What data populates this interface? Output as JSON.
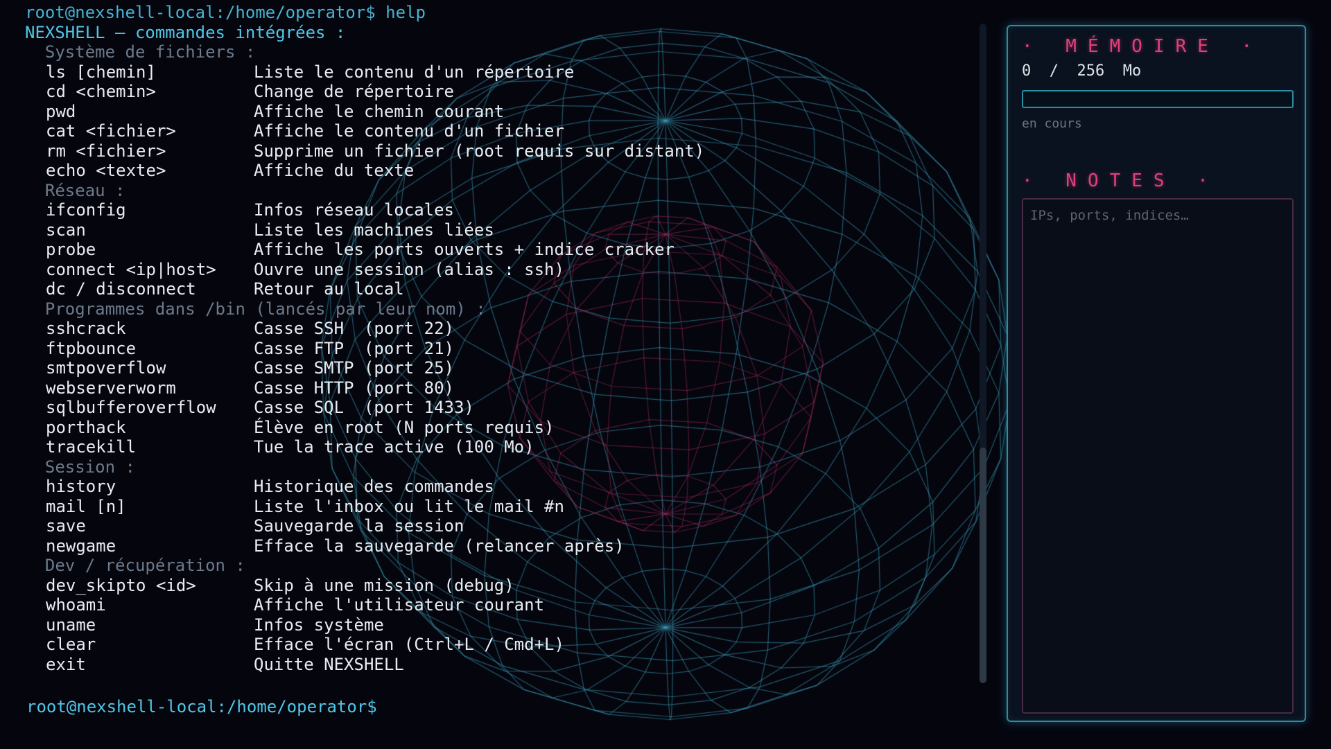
{
  "terminal": {
    "prev_prompt": "root@nexshell-local:/home/operator$ help",
    "title": "NEXSHELL — commandes intégrées :",
    "sections": [
      {
        "heading": "Système de fichiers :",
        "commands": [
          {
            "name": "ls [chemin]",
            "desc": "Liste le contenu d'un répertoire"
          },
          {
            "name": "cd <chemin>",
            "desc": "Change de répertoire"
          },
          {
            "name": "pwd",
            "desc": "Affiche le chemin courant"
          },
          {
            "name": "cat <fichier>",
            "desc": "Affiche le contenu d'un fichier"
          },
          {
            "name": "rm <fichier>",
            "desc": "Supprime un fichier (root requis sur distant)"
          },
          {
            "name": "echo <texte>",
            "desc": "Affiche du texte"
          }
        ]
      },
      {
        "heading": "Réseau :",
        "commands": [
          {
            "name": "ifconfig",
            "desc": "Infos réseau locales"
          },
          {
            "name": "scan",
            "desc": "Liste les machines liées"
          },
          {
            "name": "probe",
            "desc": "Affiche les ports ouverts + indice cracker"
          },
          {
            "name": "connect <ip|host>",
            "desc": "Ouvre une session (alias : ssh)"
          },
          {
            "name": "dc / disconnect",
            "desc": "Retour au local"
          }
        ]
      },
      {
        "heading": "Programmes dans /bin (lancés par leur nom) :",
        "commands": [
          {
            "name": "sshcrack",
            "desc": "Casse SSH  (port 22)"
          },
          {
            "name": "ftpbounce",
            "desc": "Casse FTP  (port 21)"
          },
          {
            "name": "smtpoverflow",
            "desc": "Casse SMTP (port 25)"
          },
          {
            "name": "webserverworm",
            "desc": "Casse HTTP (port 80)"
          },
          {
            "name": "sqlbufferoverflow",
            "desc": "Casse SQL  (port 1433)"
          },
          {
            "name": "porthack",
            "desc": "Élève en root (N ports requis)"
          },
          {
            "name": "tracekill",
            "desc": "Tue la trace active (100 Mo)"
          }
        ]
      },
      {
        "heading": "Session :",
        "commands": [
          {
            "name": "history",
            "desc": "Historique des commandes"
          },
          {
            "name": "mail [n]",
            "desc": "Liste l'inbox ou lit le mail #n"
          },
          {
            "name": "save",
            "desc": "Sauvegarde la session"
          },
          {
            "name": "newgame",
            "desc": "Efface la sauvegarde (relancer après)"
          }
        ]
      },
      {
        "heading": "Dev / récupération :",
        "commands": [
          {
            "name": "dev_skipto <id>",
            "desc": "Skip à une mission (debug)"
          },
          {
            "name": "whoami",
            "desc": "Affiche l'utilisateur courant"
          },
          {
            "name": "uname",
            "desc": "Infos système"
          },
          {
            "name": "clear",
            "desc": "Efface l'écran (Ctrl+L / Cmd+L)"
          },
          {
            "name": "exit",
            "desc": "Quitte NEXSHELL"
          }
        ]
      }
    ],
    "prompt": "root@nexshell-local:/home/operator$"
  },
  "memory": {
    "title": "· MÉMOIRE ·",
    "used": "0",
    "separator": "/",
    "total": "256",
    "unit": "Mo",
    "fill_fraction": 0,
    "status": "en cours"
  },
  "notes": {
    "title": "· NOTES ·",
    "placeholder": "IPs, ports, indices…"
  },
  "colors": {
    "accent_cyan": "#4fc8e6",
    "accent_pink": "#e0407a",
    "background": "#05050e"
  }
}
